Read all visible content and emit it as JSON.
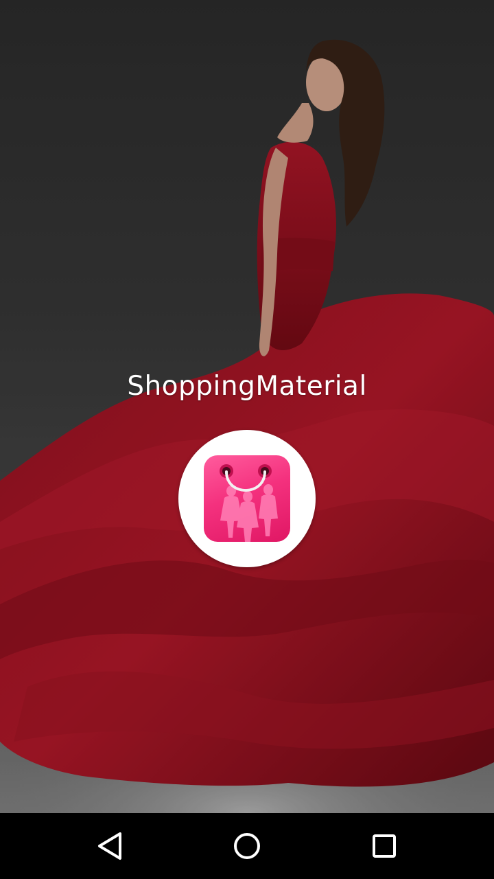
{
  "splash": {
    "app_title": "ShoppingMaterial",
    "logo_icon": "shopping-bag-icon",
    "background": "woman-red-dress-photo"
  },
  "navigation_bar": {
    "back_icon": "back-triangle-icon",
    "home_icon": "home-circle-icon",
    "recents_icon": "recents-square-icon"
  },
  "colors": {
    "logo_pink": "#f4317e",
    "dress_red": "#a3101f",
    "navbar": "#000000",
    "title_text": "#ffffff"
  }
}
